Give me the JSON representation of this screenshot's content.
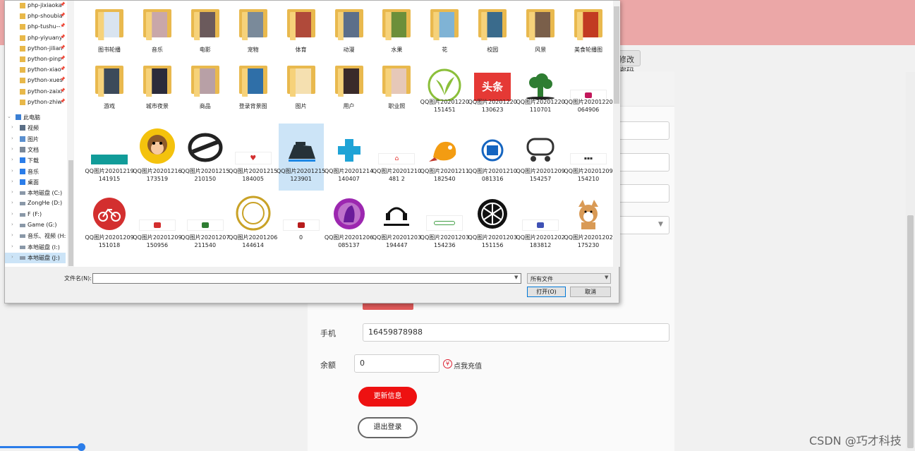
{
  "background_page": {
    "tab_button_label": "修改密码",
    "fields": {
      "phone_label": "手机",
      "phone_value": "16459878988",
      "balance_label": "余额",
      "balance_value": "0"
    },
    "recharge_link": "点我充值",
    "update_button": "更新信息",
    "logout_button": "退出登录",
    "watermark": "CSDN @巧才科技"
  },
  "dialog": {
    "nav_items": [
      {
        "label": "php-jixiaoka",
        "pinned": true,
        "icon": "folder-icon"
      },
      {
        "label": "php-shoubia",
        "pinned": true,
        "icon": "folder-icon"
      },
      {
        "label": "php-tushu--",
        "pinned": true,
        "icon": "folder-icon"
      },
      {
        "label": "php-yiyuany",
        "pinned": true,
        "icon": "folder-icon"
      },
      {
        "label": "python-jilian",
        "pinned": true,
        "icon": "folder-icon"
      },
      {
        "label": "python-pinp",
        "pinned": true,
        "icon": "folder-icon"
      },
      {
        "label": "python-xiao",
        "pinned": true,
        "icon": "folder-icon"
      },
      {
        "label": "python-xues",
        "pinned": true,
        "icon": "folder-icon"
      },
      {
        "label": "python-zaixi",
        "pinned": true,
        "icon": "folder-icon"
      },
      {
        "label": "python-zhiw",
        "pinned": true,
        "icon": "folder-icon"
      },
      {
        "label": "此电脑",
        "expanded": true,
        "icon": "computer-icon"
      },
      {
        "label": "视频",
        "icon": "video-icon"
      },
      {
        "label": "图片",
        "icon": "picture-icon"
      },
      {
        "label": "文档",
        "icon": "document-icon"
      },
      {
        "label": "下载",
        "icon": "download-icon"
      },
      {
        "label": "音乐",
        "icon": "music-icon"
      },
      {
        "label": "桌面",
        "icon": "desktop-icon"
      },
      {
        "label": "本地磁盘 (C:)",
        "icon": "drive-icon"
      },
      {
        "label": "ZongHe (D:)",
        "icon": "drive-icon"
      },
      {
        "label": "F (F:)",
        "icon": "drive-icon"
      },
      {
        "label": "Game (G:)",
        "icon": "drive-icon"
      },
      {
        "label": "音乐、视频 (H:)",
        "icon": "drive-icon"
      },
      {
        "label": "本地磁盘 (I:)",
        "icon": "drive-icon"
      },
      {
        "label": "本地磁盘 (J:)",
        "icon": "drive-icon",
        "selected": true
      }
    ],
    "items": [
      {
        "label": "图书轮播",
        "type": "folder"
      },
      {
        "label": "音乐",
        "type": "folder"
      },
      {
        "label": "电影",
        "type": "folder"
      },
      {
        "label": "宠物",
        "type": "folder"
      },
      {
        "label": "体育",
        "type": "folder"
      },
      {
        "label": "动漫",
        "type": "folder"
      },
      {
        "label": "水果",
        "type": "folder"
      },
      {
        "label": "花",
        "type": "folder"
      },
      {
        "label": "校园",
        "type": "folder"
      },
      {
        "label": "风景",
        "type": "folder"
      },
      {
        "label": "美食轮播图",
        "type": "folder"
      },
      {
        "label": "游戏",
        "type": "folder"
      },
      {
        "label": "城市夜景",
        "type": "folder"
      },
      {
        "label": "商品",
        "type": "folder"
      },
      {
        "label": "登录背景图",
        "type": "folder"
      },
      {
        "label": "图片",
        "type": "folder"
      },
      {
        "label": "用户",
        "type": "folder"
      },
      {
        "label": "职业照",
        "type": "folder"
      },
      {
        "label": "QQ图片20201220151451",
        "type": "image",
        "thumb": "leaf",
        "color": "#8bbf3a"
      },
      {
        "label": "QQ图片20201220130623",
        "type": "image",
        "thumb": "toutiao",
        "color": "#e53935",
        "text": "头条"
      },
      {
        "label": "QQ图片20201220110701",
        "type": "image",
        "thumb": "broccoli",
        "color": "#2e7d32"
      },
      {
        "label": "QQ图片20201220064906",
        "type": "image",
        "thumb": "small",
        "color": "#c2185b"
      },
      {
        "label": "QQ图片20201219141915",
        "type": "image",
        "thumb": "banner",
        "color": "#119c99"
      },
      {
        "label": "QQ图片20201216173519",
        "type": "image",
        "thumb": "monkey",
        "color": "#f4c20d"
      },
      {
        "label": "QQ图片20201215210150",
        "type": "image",
        "thumb": "slipper",
        "color": "#222222"
      },
      {
        "label": "QQ图片20201215184005",
        "type": "image",
        "thumb": "heart",
        "color": "#d32f2f"
      },
      {
        "label": "QQ图片20201215123901",
        "type": "image",
        "thumb": "iron",
        "color": "#263238",
        "selected": true
      },
      {
        "label": "QQ图片20201214140407",
        "type": "image",
        "thumb": "plus",
        "color": "#1fa3d6"
      },
      {
        "label": "QQ图片20201210481 2",
        "type": "image",
        "thumb": "house",
        "color": "#e53935"
      },
      {
        "label": "QQ图片20201211182540",
        "type": "image",
        "thumb": "dragon",
        "color": "#f39c12"
      },
      {
        "label": "QQ图片20201210081316",
        "type": "image",
        "thumb": "book",
        "color": "#1565c0"
      },
      {
        "label": "QQ图片20201209154257",
        "type": "image",
        "thumb": "tanker",
        "color": "#333333"
      },
      {
        "label": "QQ图片20201209154210",
        "type": "image",
        "thumb": "textlogo",
        "color": "#333333"
      },
      {
        "label": "QQ图片20201209151018",
        "type": "image",
        "thumb": "bike",
        "color": "#d32f2f"
      },
      {
        "label": "QQ图片20201209150956",
        "type": "image",
        "thumb": "small",
        "color": "#d32f2f"
      },
      {
        "label": "QQ图片20201207211540",
        "type": "image",
        "thumb": "small",
        "color": "#2e7d32"
      },
      {
        "label": "QQ图片20201206144614",
        "type": "image",
        "thumb": "seal",
        "color": "#c9a227"
      },
      {
        "label": "0",
        "type": "image",
        "thumb": "small",
        "color": "#b71c1c"
      },
      {
        "label": "QQ图片20201206085137",
        "type": "image",
        "thumb": "purple",
        "color": "#9c27b0"
      },
      {
        "label": "QQ图片20201203194447",
        "type": "image",
        "thumb": "music",
        "color": "#111111"
      },
      {
        "label": "QQ图片20201203154236",
        "type": "image",
        "thumb": "greenlogo",
        "color": "#43a047"
      },
      {
        "label": "QQ图片20201203151156",
        "type": "image",
        "thumb": "yamaha",
        "color": "#111111"
      },
      {
        "label": "QQ图片20201202183812",
        "type": "image",
        "thumb": "small",
        "color": "#3f51b5"
      },
      {
        "label": "QQ图片20201202175230",
        "type": "image",
        "thumb": "dog",
        "color": "#d99a55"
      }
    ],
    "filename_label": "文件名(N):",
    "filename_value": "",
    "filter_value": "所有文件",
    "open_button": "打开(O)",
    "cancel_button": "取消"
  }
}
